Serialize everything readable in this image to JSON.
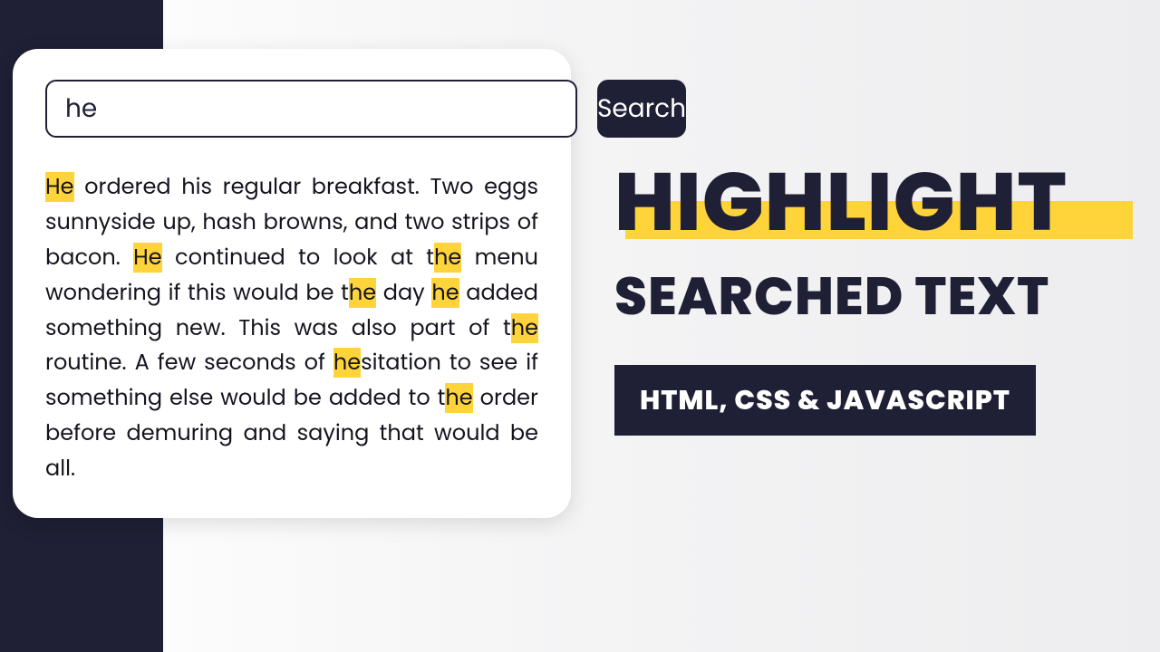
{
  "search": {
    "input_value": "he",
    "button_label": "Search",
    "query": "he"
  },
  "paragraph_text": "He ordered his regular breakfast. Two eggs sunnyside up, hash browns, and two strips of bacon. He continued to look at the menu wondering if this would be the day he added something new. This was also part of the routine. A few seconds of hesitation to see if something else would be added to the order before demuring and saying that would be all.",
  "titles": {
    "highlight": "HIGHLIGHT",
    "searched": "SEARCHED TEXT",
    "tech": "HTML, CSS & JAVASCRIPT"
  },
  "colors": {
    "dark": "#1f1f35",
    "highlight": "#ffd43b",
    "card_bg": "#ffffff"
  }
}
